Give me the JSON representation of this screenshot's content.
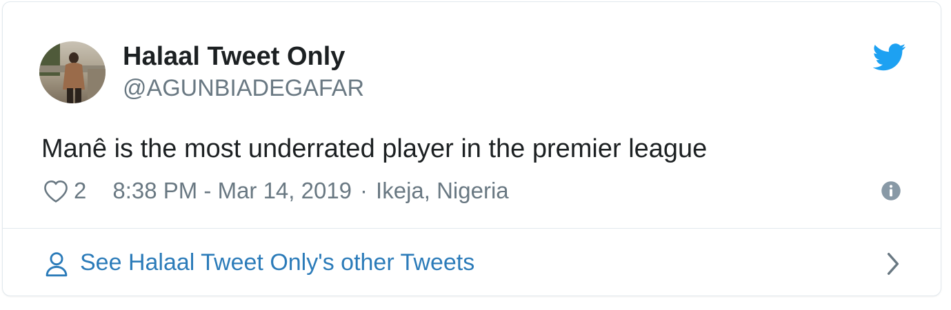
{
  "author": {
    "name": "Halaal Tweet Only",
    "handle": "@AGUNBIADEGAFAR",
    "avatar": "avatar-photo"
  },
  "brand": {
    "icon": "twitter-bird-icon",
    "color": "#1da1f2"
  },
  "tweet": {
    "text": "Manê is the most underrated player in the premier league",
    "like_count": "2",
    "timestamp": "8:38 PM - Mar 14, 2019",
    "separator": "·",
    "location": "Ikeja, Nigeria"
  },
  "icons": {
    "like": "heart-icon",
    "info": "info-icon",
    "profile": "person-icon",
    "more": "chevron-right-icon"
  },
  "footer": {
    "label": "See Halaal Tweet Only's other Tweets"
  },
  "colors": {
    "text": "#1c2022",
    "muted": "#697882",
    "link": "#2b7bb9",
    "border": "#e1e8ed"
  }
}
